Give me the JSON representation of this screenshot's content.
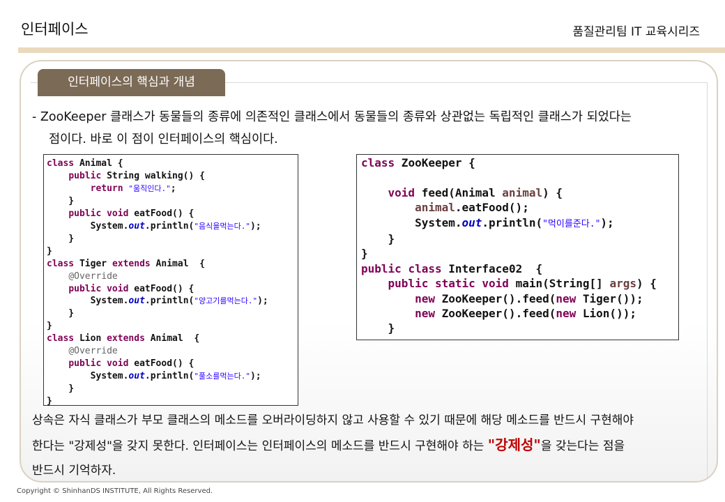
{
  "header": {
    "title": "인터페이스",
    "series": "품질관리팀 IT 교육시리즈"
  },
  "section": {
    "tag": "인터페이스의 핵심과 개념"
  },
  "intro": {
    "line1": "- ZooKeeper 클래스가 동물들의 종류에 의존적인 클래스에서 동물들의 종류와 상관없는 독립적인 클래스가 되었다는",
    "line2": "점이다. 바로 이 점이 인터페이스의 핵심이다."
  },
  "code_left": {
    "l1a": "class",
    "l1b": " Animal {",
    "l2a": "public",
    "l2b": " String walking() {",
    "l3a": "return",
    "l3s": "\"움직인다.\"",
    "l5a": "public",
    "l5k": "void",
    "l5b": " eatFood() {",
    "l6a": "System.",
    "l6f": "out",
    "l6b": ".println(",
    "l6s": "\"음식을먹는다.\"",
    "l9a": "class",
    "l9b": " Tiger ",
    "l9k": "extends",
    "l9c": " Animal  {",
    "l10": "@Override",
    "l11a": "public",
    "l11k": "void",
    "l11b": " eatFood() {",
    "l12s": "\"양고기를먹는다.\"",
    "l15a": "class",
    "l15b": " Lion ",
    "l15k": "extends",
    "l15c": " Animal  {",
    "l16": "@Override",
    "l18s": "\"풀소를먹는다.\""
  },
  "code_right": {
    "l1a": "class",
    "l1b": " ZooKeeper {",
    "l3k": "void",
    "l3b": " feed(Animal ",
    "l3p": "animal",
    "l3c": ") {",
    "l4p": "animal",
    "l4b": ".eatFood();",
    "l5a": "System.",
    "l5f": "out",
    "l5b": ".println(",
    "l5s": "\"먹이를준다.\"",
    "l8a": "public",
    "l8k": "class",
    "l8b": " Interface02  {",
    "l9a": "public",
    "l9k": "static",
    "l9k2": "void",
    "l9b": " main(String[] ",
    "l9p": "args",
    "l9c": ") {",
    "l10k": "new",
    "l10b": " ZooKeeper().feed(",
    "l10k2": "new",
    "l10c": " Tiger());",
    "l11k": "new",
    "l11b": " ZooKeeper().feed(",
    "l11k2": "new",
    "l11c": " Lion());"
  },
  "outro": {
    "line1": "상속은 자식 클래스가 부모 클래스의 메소드를 오버라이딩하지 않고 사용할 수 있기 때문에 해당 메소드를 반드시 구현해야",
    "line2a": "한다는 \"강제성\"을 갖지 못한다. 인터페이스는 인터페이스의 메소드를 반드시 구현해야 하는 ",
    "line2b": "\"강제성\"",
    "line2c": "을 갖는다는 점을",
    "line3": "반드시 기억하자."
  },
  "footer": {
    "copyright": "Copyright © ShinhanDS INSTITUTE, All Rights Reserved."
  }
}
